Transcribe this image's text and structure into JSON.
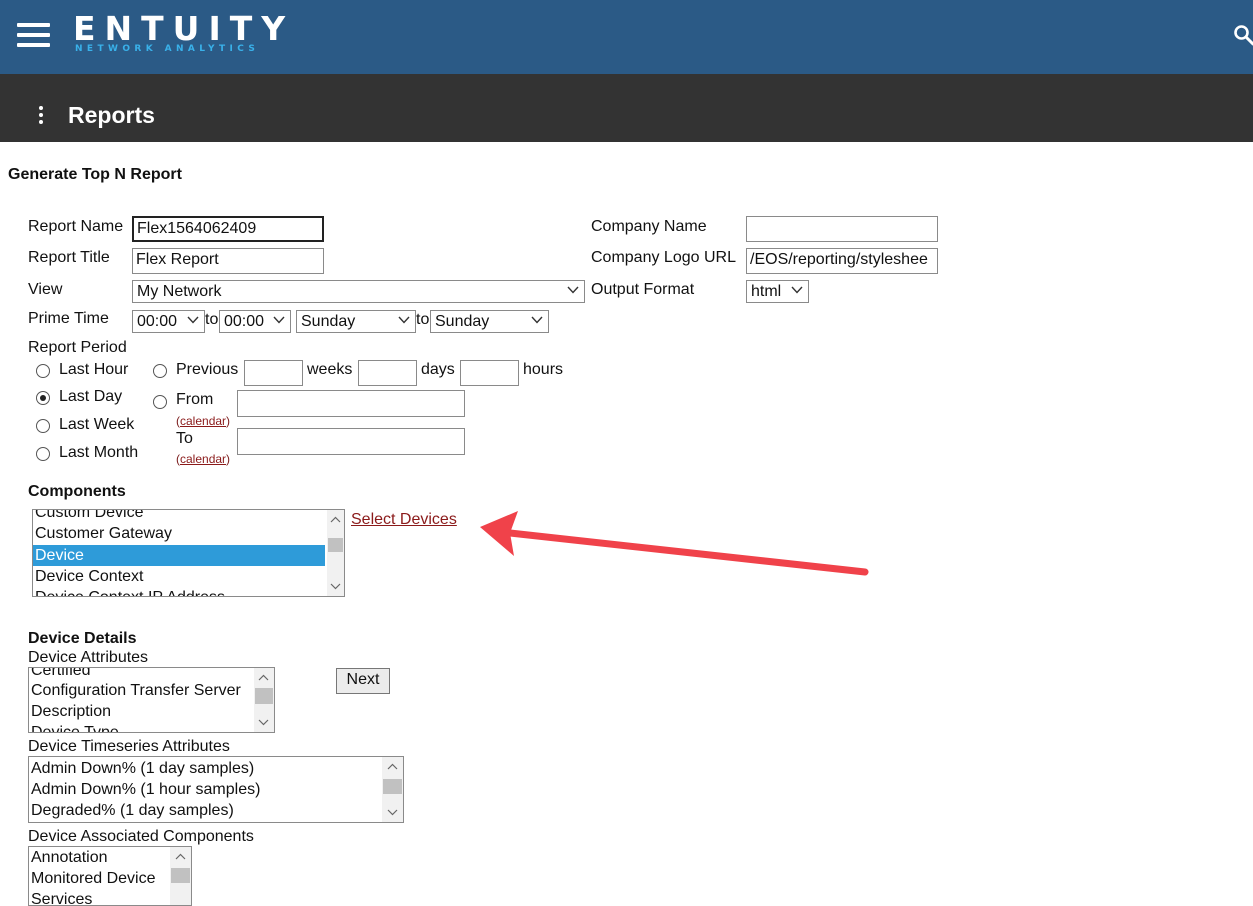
{
  "header": {
    "brand_name": "ENTUITY",
    "brand_tagline": "NETWORK ANALYTICS",
    "page_title": "Reports"
  },
  "form": {
    "heading": "Generate Top N Report",
    "report_name_label": "Report Name",
    "report_name_value": "Flex1564062409",
    "report_title_label": "Report Title",
    "report_title_value": "Flex Report",
    "view_label": "View",
    "view_value": "My Network",
    "prime_time_label": "Prime Time",
    "prime_from_time": "00:00",
    "prime_to_word": "to",
    "prime_to_time": "00:00",
    "prime_from_day": "Sunday",
    "prime_to_day": "Sunday",
    "company_name_label": "Company Name",
    "company_name_value": "",
    "company_logo_label": "Company Logo URL",
    "company_logo_value": "/EOS/reporting/styleshee",
    "output_format_label": "Output Format",
    "output_format_value": "html",
    "report_period_label": "Report Period",
    "period_last_hour": "Last Hour",
    "period_last_day": "Last Day",
    "period_last_week": "Last Week",
    "period_last_month": "Last Month",
    "period_previous": "Previous",
    "weeks_label": "weeks",
    "days_label": "days",
    "hours_label": "hours",
    "from_label": "From",
    "to_label": "To",
    "calendar_link": "calendar",
    "open_paren": "(",
    "close_paren": ")"
  },
  "components": {
    "label": "Components",
    "items": [
      "Custom Device",
      "Customer Gateway",
      "Device",
      "Device Context",
      "Device Context IP Address"
    ],
    "selected": "Device",
    "select_devices_link": "Select Devices"
  },
  "device_details": {
    "heading": "Device Details",
    "attributes_label": "Device Attributes",
    "attributes": [
      "Certified",
      "Configuration Transfer Server",
      "Description",
      "Device Type"
    ],
    "next_button": "Next",
    "timeseries_label": "Device Timeseries Attributes",
    "timeseries": [
      "Admin Down% (1 day samples)",
      "Admin Down% (1 hour samples)",
      "Degraded% (1 day samples)"
    ],
    "associated_label": "Device Associated Components",
    "associated": [
      "Annotation",
      "Monitored Device",
      "Services"
    ]
  },
  "colors": {
    "topbar": "#2b5a86",
    "subbar": "#333333",
    "tagline": "#39b1ea",
    "selection": "#2e9bd9",
    "link": "#8b1a1a",
    "arrow": "#f0424a"
  }
}
